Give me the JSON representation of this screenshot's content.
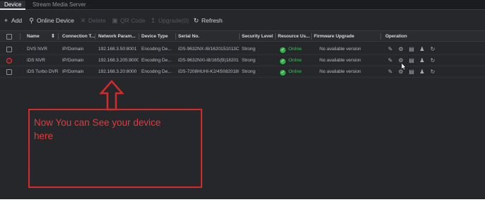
{
  "tabs": [
    {
      "label": "Device"
    },
    {
      "label": "Stream Media Server"
    }
  ],
  "toolbar": {
    "add": "Add",
    "online_device": "Online Device",
    "delete": "Delete",
    "qr_code": "QR Code",
    "upgrade": "Upgrade(0)",
    "refresh": "Refresh"
  },
  "columns": [
    "Name",
    "Connection T...",
    "Network Param...",
    "Device Type",
    "Serial No.",
    "Security Level",
    "Resource Us...",
    "Firmware Upgrade",
    "Operation"
  ],
  "rows": [
    {
      "name": "DVS NVR",
      "connection": "IP/Domain",
      "network": "192.168.3.50:8001",
      "type": "Encoding De...",
      "serial": "iDS-9632NX-I8/1620151013CCR...",
      "security": "Strong",
      "status": "Online",
      "firmware": "No available version",
      "alert": false
    },
    {
      "name": "iDS NVR",
      "connection": "IP/Domain",
      "network": "192.168.3.205:8000",
      "type": "Encoding De...",
      "serial": "iDS-9632NXI-I8/16S(B)18201...",
      "security": "Strong",
      "status": "Online",
      "firmware": "No available version",
      "alert": true
    },
    {
      "name": "iDS Turbo DVR",
      "connection": "IP/Domain",
      "network": "192.168.3.20:8000",
      "type": "Encoding De...",
      "serial": "iDS-7208HUHI-K2/4S0820180...",
      "security": "Strong",
      "status": "Online",
      "firmware": "No available version",
      "alert": false
    }
  ],
  "annotation": {
    "text": "Now You can See your device here",
    "color": "#d42a2a"
  },
  "colors": {
    "background": "#25272b",
    "online": "#39c257",
    "accent_red": "#d42a2a"
  },
  "icons": {
    "operation": [
      "edit-icon",
      "settings-icon",
      "remote-config-icon",
      "user-icon",
      "refresh-icon"
    ]
  }
}
